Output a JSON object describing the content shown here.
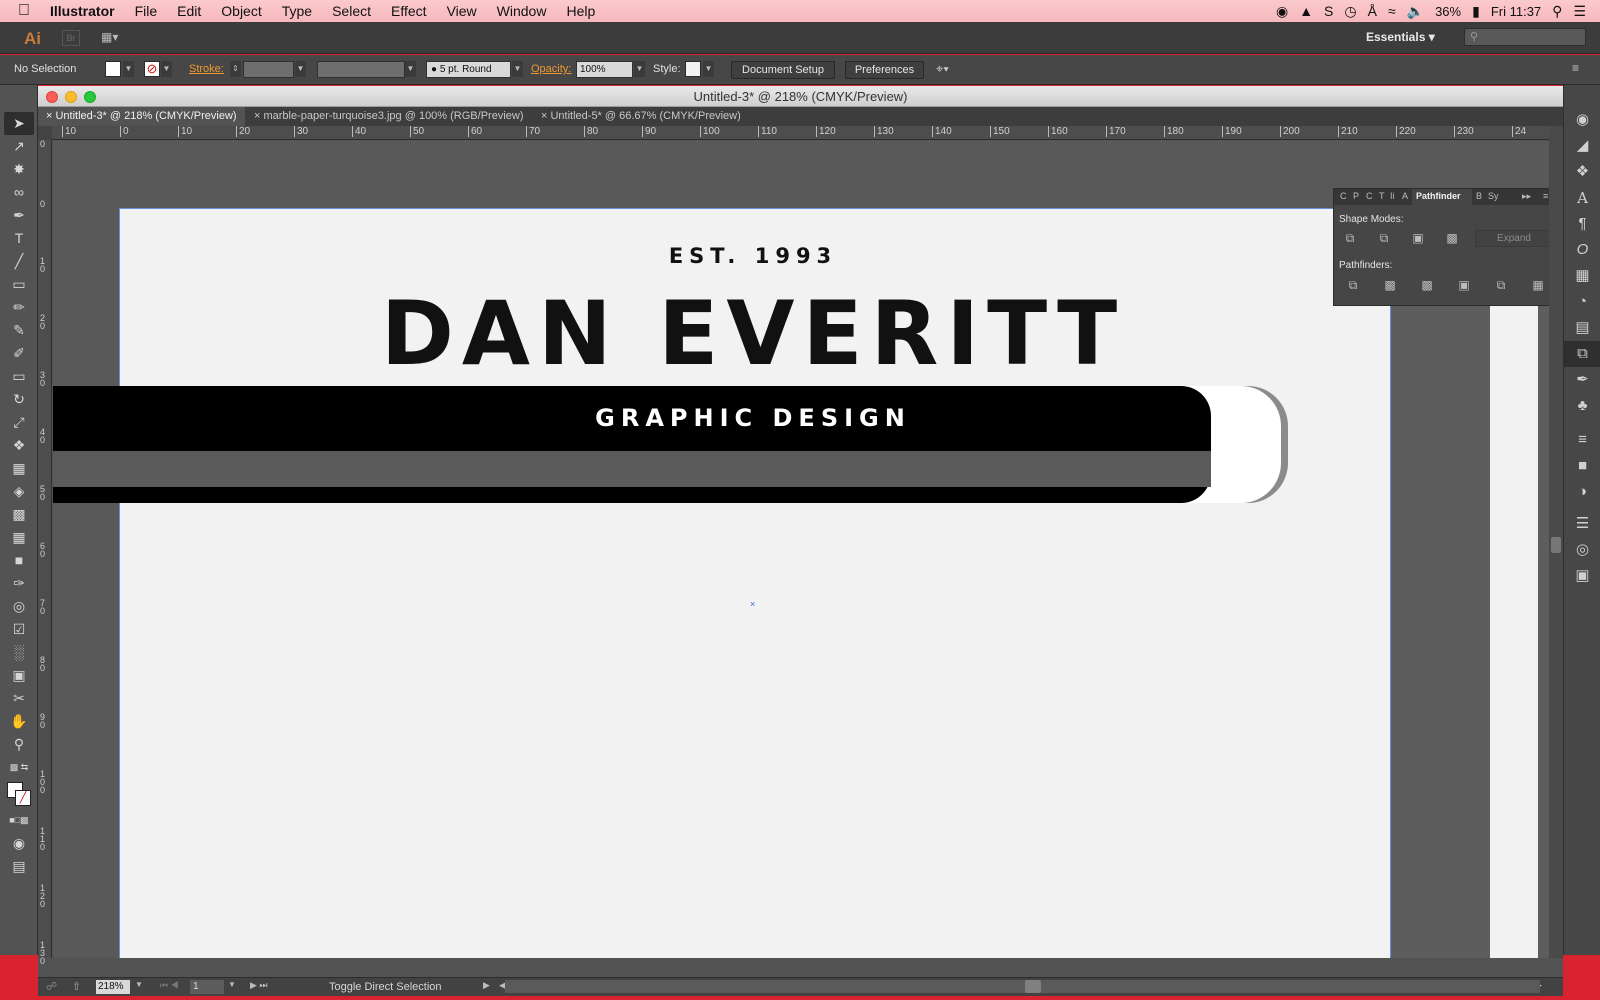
{
  "menubar": {
    "app_name": "Illustrator",
    "items": [
      "File",
      "Edit",
      "Object",
      "Type",
      "Select",
      "Effect",
      "View",
      "Window",
      "Help"
    ],
    "battery": "36%",
    "clock": "Fri 11:37"
  },
  "appbar": {
    "logo": "Ai",
    "bridge": "Br",
    "workspace": "Essentials"
  },
  "controlbar": {
    "selection": "No Selection",
    "stroke_label": "Stroke:",
    "brush": "5 pt. Round",
    "opacity_label": "Opacity:",
    "opacity_value": "100%",
    "style_label": "Style:",
    "document_setup": "Document Setup",
    "preferences": "Preferences"
  },
  "document": {
    "title": "Untitled-3* @ 218% (CMYK/Preview)",
    "tabs": [
      {
        "label": "Untitled-3* @ 218% (CMYK/Preview)",
        "active": true
      },
      {
        "label": "marble-paper-turquoise3.jpg @ 100% (RGB/Preview)",
        "active": false
      },
      {
        "label": "Untitled-5* @ 66.67% (CMYK/Preview)",
        "active": false
      }
    ],
    "ruler_labels": [
      "10",
      "0",
      "10",
      "20",
      "30",
      "40",
      "50",
      "60",
      "70",
      "80",
      "90",
      "100",
      "110",
      "120",
      "130",
      "140",
      "150",
      "160",
      "170",
      "180",
      "190",
      "200",
      "210",
      "220",
      "230",
      "24"
    ],
    "vruler_labels": [
      "0",
      "0",
      "1\n0",
      "2\n0",
      "3\n0",
      "4\n0",
      "5\n0",
      "6\n0",
      "7\n0",
      "8\n0",
      "9\n0",
      "1\n0\n0",
      "1\n1\n0",
      "1\n2\n0",
      "1\n3\n0"
    ]
  },
  "artwork": {
    "est": "EST. 1993",
    "name": "DAN EVERITT",
    "tagline": "GRAPHIC DESIGN"
  },
  "pathfinder": {
    "tab_abbrevs": [
      "C",
      "P",
      "C",
      "T",
      "Ii",
      "A"
    ],
    "active_tab": "Pathfinder",
    "other_tabs": [
      "B",
      "Sy"
    ],
    "shape_modes_label": "Shape Modes:",
    "expand": "Expand",
    "pathfinders_label": "Pathfinders:"
  },
  "statusbar": {
    "zoom": "218%",
    "artboard": "1",
    "status_text": "Toggle Direct Selection"
  },
  "colors": {
    "menubar": "#f6b9bd",
    "chrome": "#474747",
    "artboard": "#f2f2f2",
    "accent_label": "#ee9930"
  }
}
